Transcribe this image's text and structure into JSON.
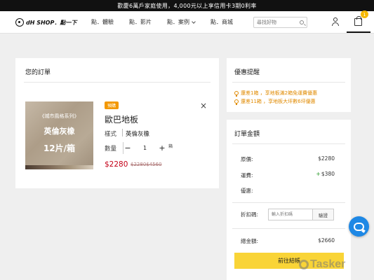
{
  "announcement": "歡慶6萬戶家庭使用，4,000元以上享信用卡3期0利率",
  "header": {
    "logo_text": "dH SHOP．點一下",
    "nav": [
      {
        "label": "點．體驗",
        "has_dropdown": false
      },
      {
        "label": "點．影片",
        "has_dropdown": false
      },
      {
        "label": "點．案例",
        "has_dropdown": true
      },
      {
        "label": "點．商城",
        "has_dropdown": false
      }
    ],
    "search_placeholder": "尋找好物",
    "cart_count": "1"
  },
  "order": {
    "title": "您的訂單",
    "item": {
      "image_series": "《城市風格系列》",
      "image_line1": "英倫灰橡",
      "image_line2": "12片/箱",
      "tag": "預購",
      "name": "歐巴地板",
      "spec_label": "樣式",
      "spec_value": "英倫灰橡",
      "qty_label": "數量",
      "qty_minus": "−",
      "qty_value": "1",
      "qty_plus": "+",
      "qty_unit": "箱",
      "price": "$2280",
      "original_price": "$2280$4560",
      "remove": "×"
    }
  },
  "promo": {
    "title": "優惠提醒",
    "lines": [
      "還差1箱 ，享地板滿2箱免運費優惠",
      "還差11箱 ，享地板大坪數6坪優惠"
    ]
  },
  "summary": {
    "title": "訂單金額",
    "rows": [
      {
        "label": "原價:",
        "value": "$2280",
        "prefix": ""
      },
      {
        "label": "運費:",
        "value": "$380",
        "prefix": "+"
      },
      {
        "label": "優惠:",
        "value": "",
        "prefix": ""
      }
    ],
    "coupon_label": "折扣碼:",
    "coupon_placeholder": "輸入折扣碼",
    "coupon_button": "驗證",
    "total_label": "總金額:",
    "total_value": "$2660",
    "checkout_button": "前往結帳"
  },
  "watermark": "Tasker",
  "colors": {
    "accent_yellow": "#f9d437",
    "price_red": "#c40018",
    "promo_orange": "#e08a00",
    "tag_orange": "#f39800",
    "chat_blue": "#1e88e5"
  }
}
